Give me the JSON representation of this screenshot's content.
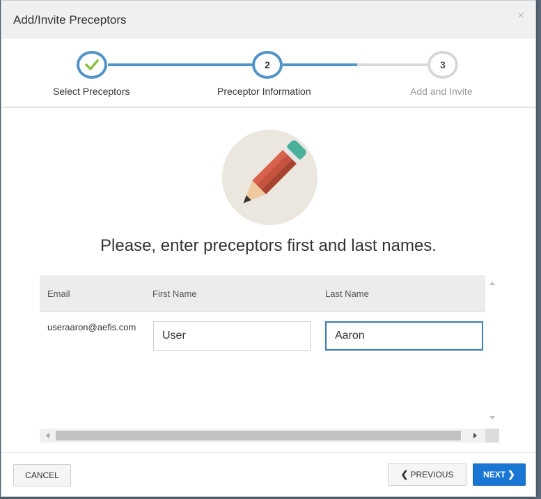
{
  "dialog": {
    "title": "Add/Invite Preceptors",
    "close_glyph": "×"
  },
  "stepper": {
    "steps": [
      {
        "label": "Select Preceptors",
        "marker": "✓",
        "state": "completed"
      },
      {
        "label": "Preceptor Information",
        "marker": "2",
        "state": "active"
      },
      {
        "label": "Add and Invite",
        "marker": "3",
        "state": "pending"
      }
    ]
  },
  "illustration": {
    "icon": "pencil-icon"
  },
  "main": {
    "heading": "Please, enter preceptors first and last names."
  },
  "table": {
    "columns": [
      "Email",
      "First Name",
      "Last Name"
    ],
    "rows": [
      {
        "email": "useraaron@aefis.com",
        "first_name": "User",
        "last_name": "Aaron"
      }
    ]
  },
  "footer": {
    "cancel_label": "CANCEL",
    "previous_label": "PREVIOUS",
    "next_label": "NEXT"
  },
  "colors": {
    "accent": "#5293c8",
    "check": "#8dc03f",
    "primary_button": "#1976d2",
    "pending": "#d7d7d7"
  }
}
